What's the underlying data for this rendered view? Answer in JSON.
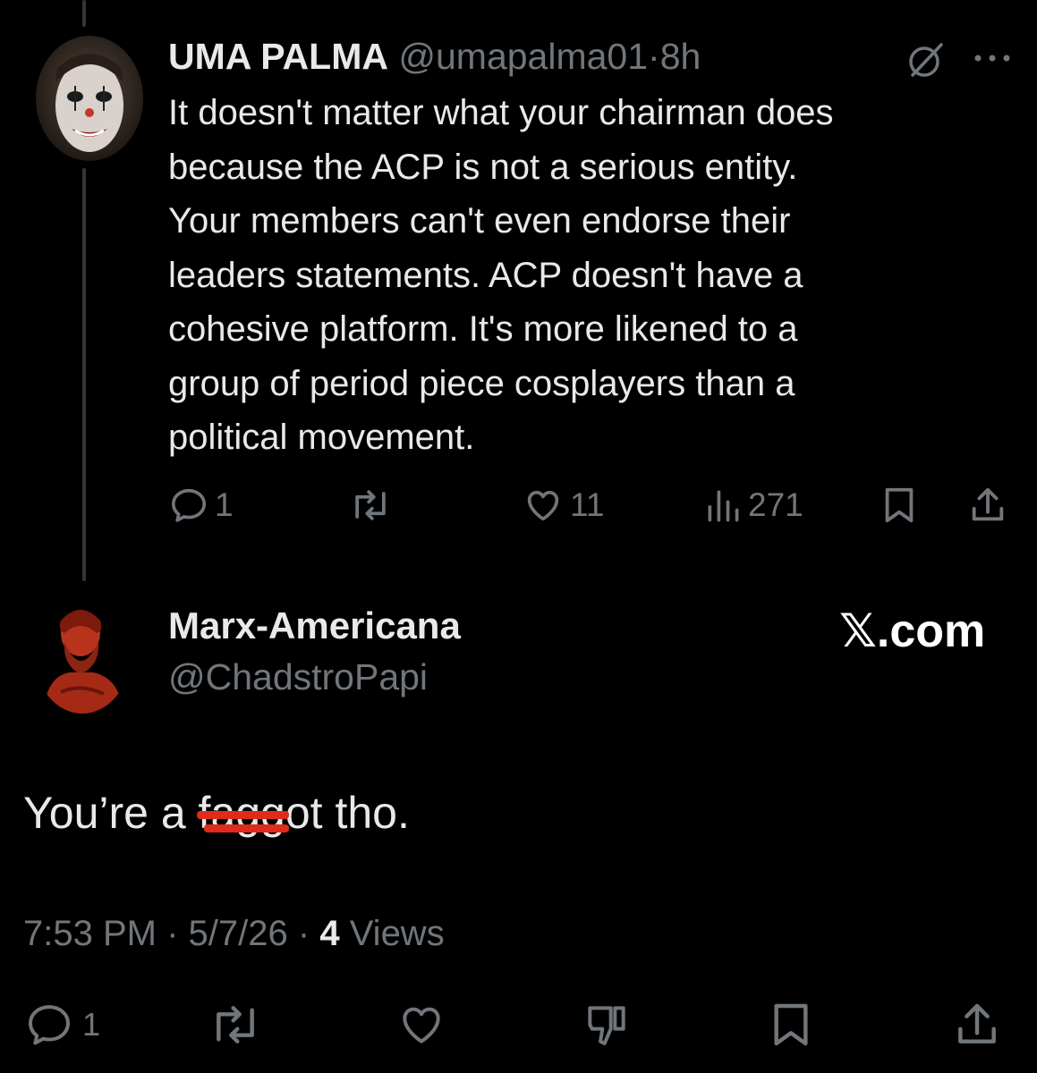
{
  "parent_tweet": {
    "display_name": "UMA PALMA",
    "handle": "@umapalma01",
    "separator": "·",
    "time_ago": "8h",
    "text": "It doesn't matter what your chairman does\nbecause the ACP is not a serious entity.\nYour members can't even endorse their\nleaders statements. ACP doesn't have a\ncohesive platform. It's more likened to a\ngroup of period piece cosplayers than a\npolitical movement.",
    "actions": {
      "replies": "1",
      "reposts": "",
      "likes": "11",
      "views": "271"
    },
    "icons": [
      "grok-icon",
      "more-icon",
      "reply-icon",
      "repost-icon",
      "like-icon",
      "views-icon",
      "bookmark-icon",
      "share-icon"
    ]
  },
  "reply_tweet": {
    "display_name": "Marx-Americana",
    "handle": "@ChadstroPapi",
    "watermark": "𝕏.com",
    "text_before": "You’re a ",
    "text_redacted": "fagg",
    "text_after": "ot tho.",
    "time": "7:53 PM",
    "separator": "·",
    "date": "5/7/26",
    "views_count": "4",
    "views_label": "Views",
    "actions": {
      "replies": "1"
    },
    "icons": [
      "reply-icon",
      "repost-icon",
      "like-icon",
      "downvote-icon",
      "bookmark-icon",
      "share-icon"
    ]
  },
  "colors": {
    "background": "#000000",
    "text_primary": "#e7e9ea",
    "text_secondary": "#71767b",
    "redaction": "#e02a1a"
  }
}
